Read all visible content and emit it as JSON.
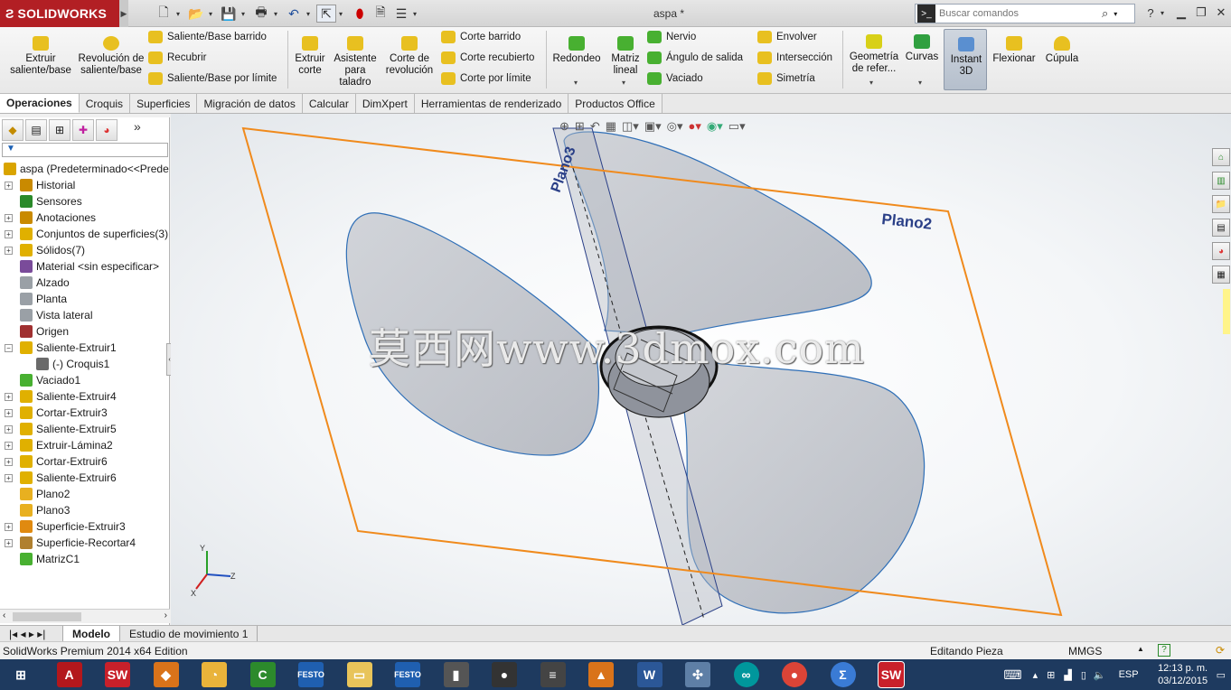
{
  "app": {
    "logo": "SOLIDWORKS",
    "doc_title": "aspa *"
  },
  "search": {
    "placeholder": "Buscar comandos"
  },
  "ribbon": {
    "extruir_saliente": "Extruir saliente/base",
    "revolucion_saliente": "Revolución de saliente/base",
    "saliente_barrido": "Saliente/Base barrido",
    "recubrir": "Recubrir",
    "saliente_limite": "Saliente/Base por límite",
    "extruir_corte": "Extruir corte",
    "asistente_taladro": "Asistente para taladro",
    "corte_revolucion": "Corte de revolución",
    "corte_barrido": "Corte barrido",
    "corte_recubierto": "Corte recubierto",
    "corte_limite": "Corte por límite",
    "redondeo": "Redondeo",
    "matriz_lineal": "Matriz lineal",
    "nervio": "Nervio",
    "angulo_salida": "Ángulo de salida",
    "vaciado": "Vaciado",
    "envolver": "Envolver",
    "interseccion": "Intersección",
    "simetria": "Simetría",
    "geometria_ref": "Geometría de refer...",
    "curvas": "Curvas",
    "instant3d": "Instant 3D",
    "flexionar": "Flexionar",
    "cupula": "Cúpula"
  },
  "tabs": [
    "Operaciones",
    "Croquis",
    "Superficies",
    "Migración de datos",
    "Calcular",
    "DimXpert",
    "Herramientas de renderizado",
    "Productos Office"
  ],
  "tree": [
    {
      "label": "aspa  (Predeterminado<<Prede",
      "pm": "",
      "icon": "part",
      "indent": 0
    },
    {
      "label": "Historial",
      "pm": "+",
      "icon": "history",
      "indent": 1
    },
    {
      "label": "Sensores",
      "pm": "",
      "icon": "sensor",
      "indent": 1
    },
    {
      "label": "Anotaciones",
      "pm": "+",
      "icon": "annot",
      "indent": 1
    },
    {
      "label": "Conjuntos de superficies(3)",
      "pm": "+",
      "icon": "surfset",
      "indent": 1
    },
    {
      "label": "Sólidos(7)",
      "pm": "+",
      "icon": "solids",
      "indent": 1
    },
    {
      "label": "Material <sin especificar>",
      "pm": "",
      "icon": "material",
      "indent": 1
    },
    {
      "label": "Alzado",
      "pm": "",
      "icon": "plane",
      "indent": 1
    },
    {
      "label": "Planta",
      "pm": "",
      "icon": "plane",
      "indent": 1
    },
    {
      "label": "Vista lateral",
      "pm": "",
      "icon": "plane",
      "indent": 1
    },
    {
      "label": "Origen",
      "pm": "",
      "icon": "origin",
      "indent": 1
    },
    {
      "label": "Saliente-Extruir1",
      "pm": "−",
      "icon": "extrude",
      "indent": 1
    },
    {
      "label": "(-) Croquis1",
      "pm": "",
      "icon": "sketch",
      "indent": 2
    },
    {
      "label": "Vaciado1",
      "pm": "",
      "icon": "shell",
      "indent": 1
    },
    {
      "label": "Saliente-Extruir4",
      "pm": "+",
      "icon": "extrude",
      "indent": 1
    },
    {
      "label": "Cortar-Extruir3",
      "pm": "+",
      "icon": "cut",
      "indent": 1
    },
    {
      "label": "Saliente-Extruir5",
      "pm": "+",
      "icon": "extrude",
      "indent": 1
    },
    {
      "label": "Extruir-Lámina2",
      "pm": "+",
      "icon": "extrude",
      "indent": 1
    },
    {
      "label": "Cortar-Extruir6",
      "pm": "+",
      "icon": "cut",
      "indent": 1
    },
    {
      "label": "Saliente-Extruir6",
      "pm": "+",
      "icon": "extrude",
      "indent": 1
    },
    {
      "label": "Plano2",
      "pm": "",
      "icon": "plane-y",
      "indent": 1
    },
    {
      "label": "Plano3",
      "pm": "",
      "icon": "plane-y",
      "indent": 1
    },
    {
      "label": "Superficie-Extruir3",
      "pm": "+",
      "icon": "surf",
      "indent": 1
    },
    {
      "label": "Superficie-Recortar4",
      "pm": "+",
      "icon": "surftrim",
      "indent": 1
    },
    {
      "label": "MatrizC1",
      "pm": "",
      "icon": "pattern",
      "indent": 1
    }
  ],
  "viewport": {
    "plane2_label": "Plano2",
    "plane3_label": "Plano3",
    "watermark": "莫西网www.3dmox.com"
  },
  "triad": {
    "x": "X",
    "y": "Y",
    "z": "Z"
  },
  "bottom_tabs": [
    "Modelo",
    "Estudio de movimiento 1"
  ],
  "status": {
    "edition": "SolidWorks Premium 2014 x64 Edition",
    "mode": "Editando Pieza",
    "units": "MMGS"
  },
  "taskbar": {
    "lang": "ESP",
    "time": "12:13 p. m.",
    "date": "03/12/2015"
  },
  "colors": {
    "brand": "#b21f24",
    "plane": "#f08a1c",
    "edge": "#2f6fb7",
    "taskbar": "#1e3a5f"
  }
}
